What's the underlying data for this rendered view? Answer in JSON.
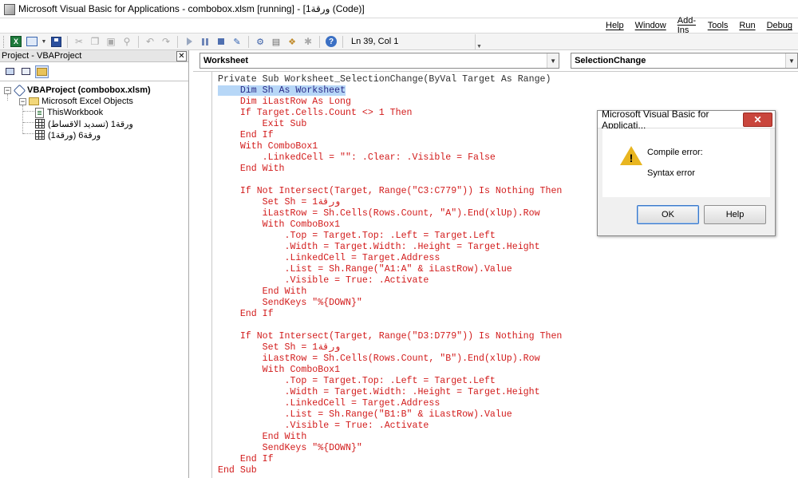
{
  "window": {
    "title": "Microsoft Visual Basic for Applications - combobox.xlsm [running] - [ورقة1 (Code)]"
  },
  "menu": [
    "Help",
    "Window",
    "Add-Ins",
    "Tools",
    "Run",
    "Debug"
  ],
  "toolbar": {
    "status": "Ln 39, Col 1"
  },
  "project_panel": {
    "title": "Project - VBAProject",
    "close": "✕",
    "tree": {
      "project": "VBAProject (combobox.xlsm)",
      "folder": "Microsoft Excel Objects",
      "items": [
        "ThisWorkbook",
        "ورقة1 (تسديد الاقساط)",
        "ورقة6 (ورقة1)"
      ]
    }
  },
  "code_window": {
    "object_combo": "Worksheet",
    "procedure_combo": "SelectionChange",
    "lines": [
      "Private Sub Worksheet_SelectionChange(ByVal Target As Range)",
      "    Dim Sh As Worksheet",
      "    Dim iLastRow As Long",
      "    If Target.Cells.Count <> 1 Then",
      "        Exit Sub",
      "    End If",
      "    With ComboBox1",
      "        .LinkedCell = \"\": .Clear: .Visible = False",
      "    End With",
      "",
      "    If Not Intersect(Target, Range(\"C3:C779\")) Is Nothing Then",
      "        Set Sh = ورقة1",
      "        iLastRow = Sh.Cells(Rows.Count, \"A\").End(xlUp).Row",
      "        With ComboBox1",
      "            .Top = Target.Top: .Left = Target.Left",
      "            .Width = Target.Width: .Height = Target.Height",
      "            .LinkedCell = Target.Address",
      "            .List = Sh.Range(\"A1:A\" & iLastRow).Value",
      "            .Visible = True: .Activate",
      "        End With",
      "        SendKeys \"%{DOWN}\"",
      "    End If",
      "",
      "    If Not Intersect(Target, Range(\"D3:D779\")) Is Nothing Then",
      "        Set Sh = ورقة1",
      "        iLastRow = Sh.Cells(Rows.Count, \"B\").End(xlUp).Row",
      "        With ComboBox1",
      "            .Top = Target.Top: .Left = Target.Left",
      "            .Width = Target.Width: .Height = Target.Height",
      "            .LinkedCell = Target.Address",
      "            .List = Sh.Range(\"B1:B\" & iLastRow).Value",
      "            .Visible = True: .Activate",
      "        End With",
      "        SendKeys \"%{DOWN}\"",
      "    End If",
      "End Sub"
    ],
    "selected_line_index": 1,
    "selected_text": "Dim Sh As Worksheet"
  },
  "dialog": {
    "title": "Microsoft Visual Basic for Applicati...",
    "close": "✕",
    "message_1": "Compile error:",
    "message_2": "Syntax error",
    "ok_label": "OK",
    "help_label": "Help"
  },
  "colors": {
    "code_error_red": "#d21b1b",
    "selection_blue": "#b7d7f7",
    "close_button_red": "#c9463d"
  }
}
